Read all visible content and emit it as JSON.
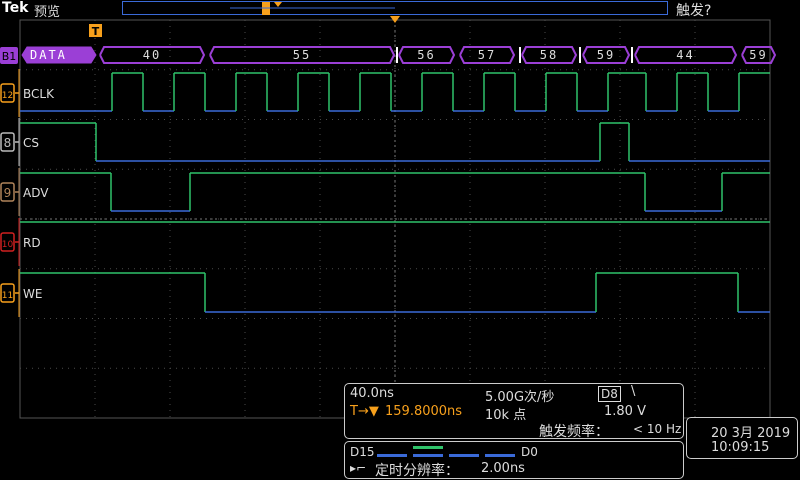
{
  "header": {
    "brand": "Tek",
    "mode": "预览",
    "trigger_status": "触发?"
  },
  "trigger_marker_label": "T",
  "bus": {
    "label": "B1",
    "name": "DATA",
    "values": [
      "40",
      "55",
      "56",
      "57",
      "58",
      "59",
      "44",
      "59"
    ]
  },
  "channels": [
    {
      "number": "12",
      "label": "BCLK",
      "color": "#f7a01c"
    },
    {
      "number": "8",
      "label": "CS",
      "color": "#bbbbbb"
    },
    {
      "number": "9",
      "label": "ADV",
      "color": "#b0845a"
    },
    {
      "number": "10",
      "label": "RD",
      "color": "#d02020"
    },
    {
      "number": "11",
      "label": "WE",
      "color": "#f7a01c"
    }
  ],
  "readout": {
    "timebase": "40.0ns",
    "sample_rate": "5.00G次/秒",
    "trigger_source": "D8",
    "trigger_slope": "\\",
    "trigger_position": "159.8000ns",
    "record_length": "10k 点",
    "trigger_level": "1.80 V",
    "trigger_freq_label": "触发频率：",
    "trigger_freq_value": "< 10 Hz"
  },
  "datetime": {
    "date": "20 3月 2019",
    "time": "10:09:15"
  },
  "digital": {
    "high_label": "D15",
    "low_label": "D0",
    "timing_label": "定时分辨率：",
    "timing_value": "2.00ns"
  },
  "colors": {
    "bus": "#9b3fd6",
    "trace_high": "#2fc36a",
    "trace_low": "#3a6ad8",
    "grid": "#4a4a4a",
    "accent": "#f7a01c"
  }
}
